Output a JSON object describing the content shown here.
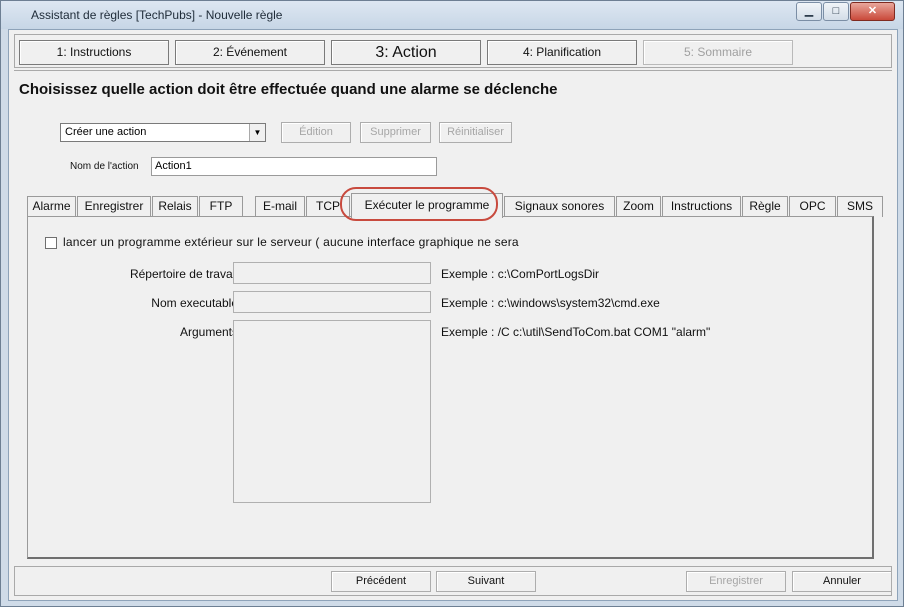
{
  "window": {
    "title": "Assistant de règles [TechPubs] - Nouvelle règle",
    "minimize": "▁",
    "maximize": "□",
    "close": "✕"
  },
  "steps": [
    {
      "label": "1: Instructions"
    },
    {
      "label": "2: Événement"
    },
    {
      "label": "3: Action"
    },
    {
      "label": "4: Planification"
    },
    {
      "label": "5: Sommaire"
    }
  ],
  "main": {
    "heading": "Choisissez quelle action doit être effectuée quand une alarme se déclenche",
    "action_select": {
      "value": "Créer une action",
      "arrow": "▼"
    },
    "buttons": {
      "edit": "Édition",
      "delete": "Supprimer",
      "reset": "Réinitialiser"
    },
    "action_name": {
      "label": "Nom de l'action",
      "value": "Action1"
    }
  },
  "tabs": [
    "Alarme",
    "Enregistrer",
    "Relais",
    "FTP",
    "E-mail",
    "TCP",
    "Exécuter le programme",
    "Signaux sonores",
    "Zoom",
    "Instructions",
    "Règle",
    "OPC",
    "SMS"
  ],
  "panel": {
    "checkbox_label": "lancer un programme extérieur sur le serveur ( aucune interface graphique ne sera",
    "fields": [
      {
        "label": "Répertoire de travail",
        "example": "Exemple : c:\\ComPortLogsDir"
      },
      {
        "label": "Nom executable",
        "example": "Exemple : c:\\windows\\system32\\cmd.exe"
      },
      {
        "label": "Arguments",
        "example": "Exemple : /C c:\\util\\SendToCom.bat COM1 \"alarm\""
      }
    ]
  },
  "footer": {
    "previous": "Précédent",
    "next": "Suivant",
    "save": "Enregistrer",
    "cancel": "Annuler"
  }
}
